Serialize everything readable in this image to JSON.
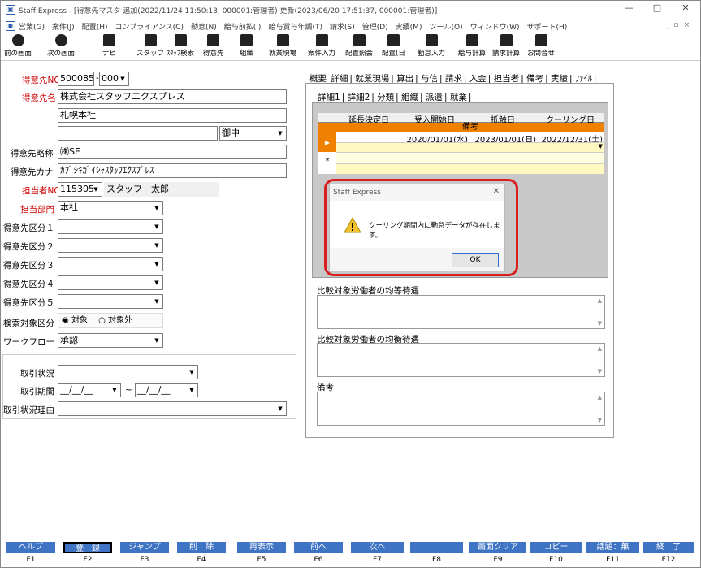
{
  "window": {
    "title": "Staff Express - [得意先マスタ 追加(2022/11/24 11:50:13, 000001:管理者) 更新(2023/06/20 17:51:37, 000001:管理者)]",
    "controls": [
      "—",
      "□",
      "✕"
    ],
    "mdi_controls": [
      "_",
      "▫",
      "×"
    ]
  },
  "menu": [
    "営業(G)",
    "案件(J)",
    "配置(H)",
    "コンプライアンス(C)",
    "勤怠(N)",
    "給与前払(I)",
    "給与賞与年調(T)",
    "請求(S)",
    "管理(D)",
    "実績(M)",
    "ツール(O)",
    "ウィンドウ(W)",
    "サポート(H)"
  ],
  "toolbar": [
    {
      "label": "前の画面",
      "icon": "back-icon"
    },
    {
      "label": "次の画面",
      "icon": "forward-icon"
    },
    {
      "label": "ナビ",
      "icon": "navi-icon"
    },
    {
      "label": "スタッフ",
      "icon": "staff-icon"
    },
    {
      "label": "ｽﾀｯﾌ検索",
      "icon": "staff-search-icon"
    },
    {
      "label": "得意先",
      "icon": "customer-icon"
    },
    {
      "label": "組織",
      "icon": "org-icon"
    },
    {
      "label": "就業現場",
      "icon": "worksite-icon"
    },
    {
      "label": "案件入力",
      "icon": "job-input-icon"
    },
    {
      "label": "配置照会",
      "icon": "placement-query-icon"
    },
    {
      "label": "配置(日",
      "icon": "placement-day-icon"
    },
    {
      "label": "勤怠入力",
      "icon": "attendance-icon"
    },
    {
      "label": "給与計算",
      "icon": "payroll-icon"
    },
    {
      "label": "請求計算",
      "icon": "billing-icon"
    },
    {
      "label": "お問合せ",
      "icon": "inquiry-icon"
    }
  ],
  "form": {
    "customer_no_label": "得意先NO",
    "customer_no": "500085",
    "customer_no_sep": "-",
    "customer_sub": "000",
    "customer_name_label": "得意先名",
    "customer_name": "株式会社スタッフエクスプレス",
    "customer_name2": "札幌本社",
    "customer_name3": "",
    "honorific": "御中",
    "short_name_label": "得意先略称",
    "short_name": "㈱SE",
    "kana_label": "得意先カナ",
    "kana": "ｶﾌﾞｼｷｶﾞｲｼｬｽﾀｯﾌｴｸｽﾌﾟﾚｽ",
    "person_no_label": "担当者NO",
    "person_no": "115305",
    "person_name": "スタッフ　太郎",
    "dept_label": "担当部門",
    "dept": "本社",
    "categories": [
      {
        "label": "得意先区分１",
        "value": ""
      },
      {
        "label": "得意先区分２",
        "value": ""
      },
      {
        "label": "得意先区分３",
        "value": ""
      },
      {
        "label": "得意先区分４",
        "value": ""
      },
      {
        "label": "得意先区分５",
        "value": ""
      }
    ],
    "search_target_label": "検索対象区分",
    "radio_on": "対象",
    "radio_off": "対象外",
    "workflow_label": "ワークフロー",
    "workflow": "承認",
    "trade_status_label": "取引状況",
    "trade_status": "",
    "trade_period_label": "取引期間",
    "date_from": "__/__/__",
    "tilde": "~",
    "date_to": "__/__/__",
    "trade_reason_label": "取引状況理由",
    "trade_reason": ""
  },
  "tabs_main": [
    "概要",
    "詳細",
    "就業現場",
    "算出",
    "与信",
    "請求",
    "入金",
    "担当者",
    "備考",
    "実績",
    "ﾌｧｲﾙ"
  ],
  "tabs_sub": [
    "詳細1",
    "詳細2",
    "分類",
    "組織",
    "派遣",
    "就業"
  ],
  "grid": {
    "headers": [
      "延長決定日",
      "受入開始日",
      "抵触日",
      "クーリング日"
    ],
    "subheader": "備考",
    "row": [
      "",
      "2020/01/01(水)",
      "2023/01/01(日)",
      "2022/12/31(土)"
    ],
    "new_row_marker": "*"
  },
  "memo1_label": "比較対象労働者の均等待遇",
  "memo2_label": "比較対象労働者の均衡待遇",
  "memo3_label": "備考",
  "dialog": {
    "title": "Staff Express",
    "message": "クーリング期間内に勤怠データが存在します。",
    "ok": "OK",
    "close": "✕"
  },
  "fkeys": [
    {
      "label": "ヘルプ",
      "key": "F1"
    },
    {
      "label": "登　録",
      "key": "F2"
    },
    {
      "label": "ジャンプ",
      "key": "F3"
    },
    {
      "label": "削　除",
      "key": "F4"
    },
    {
      "label": "再表示",
      "key": "F5"
    },
    {
      "label": "前へ",
      "key": "F6"
    },
    {
      "label": "次へ",
      "key": "F7"
    },
    {
      "label": "",
      "key": "F8"
    },
    {
      "label": "画面クリア",
      "key": "F9"
    },
    {
      "label": "コピー",
      "key": "F10"
    },
    {
      "label": "話題：無",
      "key": "F11"
    },
    {
      "label": "終　了",
      "key": "F12"
    }
  ],
  "colors": {
    "accent": "#3f73c3",
    "required_label": "#cc0000",
    "grid_header": "#f08000",
    "dialog_highlight": "#d81e1e"
  }
}
